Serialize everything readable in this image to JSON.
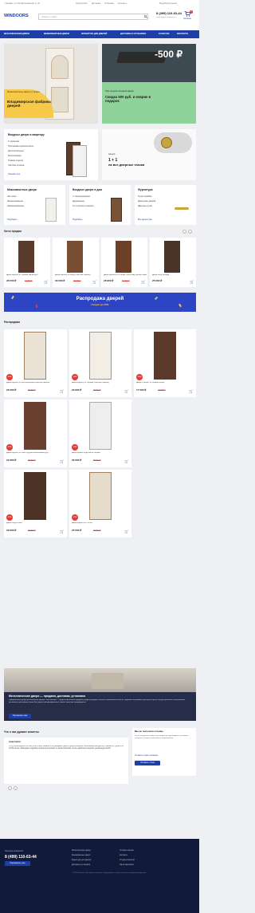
{
  "topbar": {
    "location": "г. Москва, ул. Мосфильмовская, д. 12",
    "links": [
      "Покупателю",
      "Доставка",
      "Установка",
      "Контакты"
    ],
    "login": "Вход/Регистрация",
    "favorites": "Избранное"
  },
  "header": {
    "logo": "WINDOORS",
    "search_placeholder": "Поиск по сайту",
    "phone": "8 (499) 110-63-44",
    "phone_sub": "Бесплатный звонок 24/7",
    "cart_label": "Корзина",
    "cart_count": "0"
  },
  "nav": [
    "МЕТАЛЛИЧЕСКИЕ ДВЕРИ",
    "МЕЖКОМНАТНЫЕ ДВЕРИ",
    "ФУРНИТУРА ДЛЯ ДВЕРЕЙ",
    "ДОСТАВКА И УСТАНОВКА",
    "ГАЗОСТОЕ",
    "КОНТАКТЫ"
  ],
  "banner1": {
    "tag": "Межкомнатные двери по акции",
    "title": "Владимирская фабрика дверей"
  },
  "banner2": {
    "big": "-500 ₽",
    "line1": "При покупке входной двери",
    "line2": "Скидка 500 руб. и коврик в подарок"
  },
  "entry": {
    "title": "Входные двери в квартиру",
    "items": [
      "С зеркалом",
      "Программа шумоизоляции",
      "Десятиклассные",
      "Белоснежные",
      "Темная отделка",
      "Светлая отделка"
    ],
    "more": "Показать все"
  },
  "promo": {
    "label": "Акция",
    "line1": "1 + 1",
    "line2": "на все дверные глазки"
  },
  "interior": {
    "title": "Межкомнатные двери",
    "items": [
      "Эко шпон",
      "Шпонированные",
      "Ламинированные"
    ],
    "more": "Подобрать"
  },
  "house": {
    "title": "Входные двери в дом",
    "items": [
      "С терморазрывом",
      "Деревянные",
      "Со стеклом в комнате"
    ],
    "more": "Подобрать"
  },
  "hardware": {
    "title": "Фурнитура",
    "items": [
      "Ручки AvelMax",
      "Доводчики дверей",
      "Дверные ручки"
    ],
    "more": "Все фурнитура"
  },
  "hits": {
    "title": "Хиты продаж",
    "items": [
      {
        "name": "Дверь Цербер 11 Черный Белый Дуб",
        "price": "28 000 ₽",
        "old": "32 000 ₽"
      },
      {
        "name": "Дверь Цербер 36 Муар (Светлая Панель)",
        "price": "33 000 ₽",
        "old": "38 000 ₽"
      },
      {
        "name": "Дверь Цербер 14 Сталарт Антик мед (Белая Панель)",
        "price": "28 900 ₽",
        "old": "32 000 ₽"
      },
      {
        "name": "Дверь АСД Легенда",
        "price": "25 900 ₽",
        "old": ""
      }
    ]
  },
  "sale_banner": {
    "title": "Распродажа дверей",
    "sub": "Скидки до 50%"
  },
  "sale": {
    "title": "Распродажа",
    "items": [
      {
        "name": "Дверь Цербер 36 Мустанга Венге(Светлая панель)",
        "price": "25 000 ₽",
        "old": "30 000 ₽",
        "badge": "-15%"
      },
      {
        "name": "Дверь Цербер 11 Черный (Светлая Панель)",
        "price": "23 900 ₽",
        "old": "29 000 ₽",
        "badge": "-20%"
      },
      {
        "name": "Дверь Сталарт 28 Сахара белый",
        "price": "17 000 ₽",
        "old": "24 000 ₽",
        "badge": "-30%"
      },
      {
        "name": "Дверь Цербер 36 Лофт Муррен Выбеленный Дуб",
        "price": "22 900 ₽",
        "old": "25 900 ₽",
        "badge": "-10%"
      },
      {
        "name": "Дверь Бримо Муар Капле черная",
        "price": "33 000 ₽",
        "old": "38 000 ₽",
        "badge": "-14%"
      },
      {
        "name": "Дверь АСД Атлант",
        "price": "29 000 ₽",
        "old": "33 000 ₽",
        "badge": "-12%"
      },
      {
        "name": "Дверь Цербер 36 Тесла",
        "price": "25 500 ₽",
        "old": "29 800 ₽",
        "badge": "-15%"
      }
    ]
  },
  "about": {
    "title": "Металлические двери — продажа, доставка, установка",
    "text": "Официальный дилер металлических дверей. Наш магазин — профессиональный продавец входных дверей в Москве и Московской области. Широкий ассортимент, доступные цены, быстрая доставка и качественная установка в кратчайшие сроки. Все двери сертифицированы и имеют гарантию производителя.",
    "button": "Перезвонить мне"
  },
  "reviews": {
    "title": "Что о нас думают клиенты",
    "author": "Анастасия",
    "text": "Хочу поблагодарить за быстрое и качественное обслуживание! Дверь пришла вовремя, монтажники аккуратно установили, убрали за собой мусор. Менеджер подробно проконсультировал по всем вопросам. Очень довольна покупкой, рекомендую всем!",
    "side_title": "Мы не получили отзывы",
    "side_text": "Мы не получили отзывы и не сможем их опубликовать без вашего согласия. Оставьте свой отзыв о нашей работе.",
    "side_link": "Оставить отзыв о магазине",
    "side_button": "Оставить отзыв"
  },
  "footer": {
    "ask": "Остались вопросы?",
    "phone": "8 (499) 110-63-44",
    "button": "Перезвонить мне",
    "col1": [
      "Металлические двери",
      "Межкомнатные двери",
      "Фурнитура для дверей",
      "Доставка и установка"
    ],
    "col2": [
      "Условия покупки",
      "Контакты",
      "Отзывы клиентов",
      "Карта магазинов"
    ],
    "copy": "© 2023 Windoors. Все права защищены. Информация на сайте не является публичной офертой."
  }
}
